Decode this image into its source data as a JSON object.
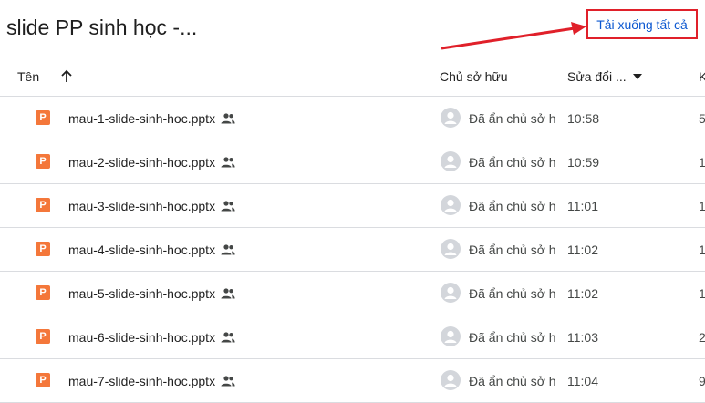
{
  "folder_title": "slide PP sinh học -...",
  "download_all_label": "Tải xuống tất cả",
  "columns": {
    "name": "Tên",
    "owner": "Chủ sở hữu",
    "modified": "Sửa đổi ...",
    "size": "K"
  },
  "icons": {
    "file_type": "powerpoint-icon",
    "file_badge_letter": "P",
    "shared": "shared-people-icon",
    "avatar": "anonymous-user-avatar",
    "sort": "arrow-up-icon",
    "modified_dropdown": "caret-down-icon"
  },
  "colors": {
    "accent_link": "#0b57d0",
    "annotation_red": "#e0202a",
    "powerpoint_orange": "#f4773a"
  },
  "files": [
    {
      "name": "mau-1-slide-sinh-hoc.pptx",
      "owner": "Đã ẩn chủ sở h",
      "modified": "10:58",
      "size": "5"
    },
    {
      "name": "mau-2-slide-sinh-hoc.pptx",
      "owner": "Đã ẩn chủ sở h",
      "modified": "10:59",
      "size": "1"
    },
    {
      "name": "mau-3-slide-sinh-hoc.pptx",
      "owner": "Đã ẩn chủ sở h",
      "modified": "11:01",
      "size": "1"
    },
    {
      "name": "mau-4-slide-sinh-hoc.pptx",
      "owner": "Đã ẩn chủ sở h",
      "modified": "11:02",
      "size": "1"
    },
    {
      "name": "mau-5-slide-sinh-hoc.pptx",
      "owner": "Đã ẩn chủ sở h",
      "modified": "11:02",
      "size": "1"
    },
    {
      "name": "mau-6-slide-sinh-hoc.pptx",
      "owner": "Đã ẩn chủ sở h",
      "modified": "11:03",
      "size": "2"
    },
    {
      "name": "mau-7-slide-sinh-hoc.pptx",
      "owner": "Đã ẩn chủ sở h",
      "modified": "11:04",
      "size": "9"
    }
  ]
}
